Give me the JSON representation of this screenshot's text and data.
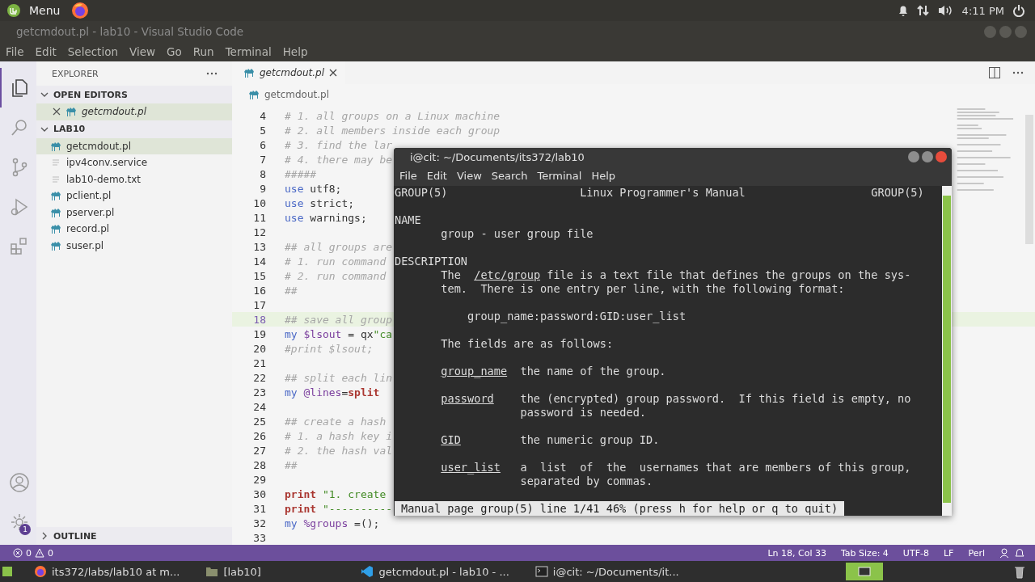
{
  "top_panel": {
    "menu_label": "Menu",
    "clock": "4:11 PM"
  },
  "window": {
    "title": "getcmdout.pl - lab10 - Visual Studio Code"
  },
  "menu_bar": [
    "File",
    "Edit",
    "Selection",
    "View",
    "Go",
    "Run",
    "Terminal",
    "Help"
  ],
  "activity_bar": {
    "items": [
      {
        "selected": true
      },
      {
        "selected": false
      },
      {
        "selected": false
      },
      {
        "selected": false
      },
      {
        "selected": false
      }
    ],
    "settings_badge": "1"
  },
  "sidebar": {
    "title": "EXPLORER",
    "sections": [
      {
        "title": "OPEN EDITORS",
        "expanded": true,
        "items": [
          {
            "name": "getcmdout.pl",
            "kind": "perl",
            "selected": true,
            "closable": true
          }
        ]
      },
      {
        "title": "LAB10",
        "expanded": true,
        "items": [
          {
            "name": "getcmdout.pl",
            "kind": "perl",
            "selected": true,
            "closable": false
          },
          {
            "name": "ipv4conv.service",
            "kind": "text",
            "selected": false,
            "closable": false
          },
          {
            "name": "lab10-demo.txt",
            "kind": "text",
            "selected": false,
            "closable": false
          },
          {
            "name": "pclient.pl",
            "kind": "perl",
            "selected": false,
            "closable": false
          },
          {
            "name": "pserver.pl",
            "kind": "perl",
            "selected": false,
            "closable": false
          },
          {
            "name": "record.pl",
            "kind": "perl",
            "selected": false,
            "closable": false
          },
          {
            "name": "suser.pl",
            "kind": "perl",
            "selected": false,
            "closable": false
          }
        ]
      },
      {
        "title": "OUTLINE",
        "expanded": false
      }
    ]
  },
  "editor": {
    "tab": "getcmdout.pl",
    "breadcrumb": "getcmdout.pl",
    "lines": [
      {
        "number": "4",
        "highlighted": false,
        "tokens": [
          {
            "text": "# 1. all groups on a Linux machine",
            "kind": "comment"
          }
        ]
      },
      {
        "number": "5",
        "highlighted": false,
        "tokens": [
          {
            "text": "# 2. all members inside each group",
            "kind": "comment"
          }
        ]
      },
      {
        "number": "6",
        "highlighted": false,
        "tokens": [
          {
            "text": "# 3. find the lar",
            "kind": "comment"
          }
        ]
      },
      {
        "number": "7",
        "highlighted": false,
        "tokens": [
          {
            "text": "# 4. there may be",
            "kind": "comment"
          }
        ]
      },
      {
        "number": "8",
        "highlighted": false,
        "tokens": [
          {
            "text": "#####",
            "kind": "comment"
          }
        ]
      },
      {
        "number": "9",
        "highlighted": false,
        "tokens": [
          {
            "text": "use",
            "kind": "keyword"
          },
          {
            "text": " utf8;",
            "kind": "plain"
          }
        ]
      },
      {
        "number": "10",
        "highlighted": false,
        "tokens": [
          {
            "text": "use",
            "kind": "keyword"
          },
          {
            "text": " strict;",
            "kind": "plain"
          }
        ]
      },
      {
        "number": "11",
        "highlighted": false,
        "tokens": [
          {
            "text": "use",
            "kind": "keyword"
          },
          {
            "text": " warnings;",
            "kind": "plain"
          }
        ]
      },
      {
        "number": "12",
        "highlighted": false
      },
      {
        "number": "13",
        "highlighted": false,
        "tokens": [
          {
            "text": "## all groups are",
            "kind": "comment"
          }
        ]
      },
      {
        "number": "14",
        "highlighted": false,
        "tokens": [
          {
            "text": "# 1. run command",
            "kind": "comment"
          }
        ]
      },
      {
        "number": "15",
        "highlighted": false,
        "tokens": [
          {
            "text": "# 2. run command",
            "kind": "comment"
          }
        ]
      },
      {
        "number": "16",
        "highlighted": false,
        "tokens": [
          {
            "text": "##",
            "kind": "comment"
          }
        ]
      },
      {
        "number": "17",
        "highlighted": false
      },
      {
        "number": "18",
        "highlighted": true,
        "tokens": [
          {
            "text": "## save all group",
            "kind": "comment"
          }
        ]
      },
      {
        "number": "19",
        "highlighted": false,
        "tokens": [
          {
            "text": "my",
            "kind": "keyword"
          },
          {
            "text": " $lsout",
            "kind": "variable"
          },
          {
            "text": " = qx",
            "kind": "plain"
          },
          {
            "text": "\"ca",
            "kind": "string"
          }
        ]
      },
      {
        "number": "20",
        "highlighted": false,
        "tokens": [
          {
            "text": "#print $lsout;",
            "kind": "comment"
          }
        ]
      },
      {
        "number": "21",
        "highlighted": false
      },
      {
        "number": "22",
        "highlighted": false,
        "tokens": [
          {
            "text": "## split each lin",
            "kind": "comment"
          }
        ]
      },
      {
        "number": "23",
        "highlighted": false,
        "tokens": [
          {
            "text": "my",
            "kind": "keyword"
          },
          {
            "text": " @lines",
            "kind": "variable"
          },
          {
            "text": "=",
            "kind": "plain"
          },
          {
            "text": "split",
            "kind": "function"
          }
        ]
      },
      {
        "number": "24",
        "highlighted": false
      },
      {
        "number": "25",
        "highlighted": false,
        "tokens": [
          {
            "text": "## create a hash",
            "kind": "comment"
          }
        ]
      },
      {
        "number": "26",
        "highlighted": false,
        "tokens": [
          {
            "text": "# 1. a hash key i",
            "kind": "comment"
          }
        ]
      },
      {
        "number": "27",
        "highlighted": false,
        "tokens": [
          {
            "text": "# 2. the hash val",
            "kind": "comment"
          }
        ]
      },
      {
        "number": "28",
        "highlighted": false,
        "tokens": [
          {
            "text": "##",
            "kind": "comment"
          }
        ]
      },
      {
        "number": "29",
        "highlighted": false
      },
      {
        "number": "30",
        "highlighted": false,
        "tokens": [
          {
            "text": "print",
            "kind": "function"
          },
          {
            "text": " \"1. create",
            "kind": "string"
          }
        ]
      },
      {
        "number": "31",
        "highlighted": false,
        "tokens": [
          {
            "text": "print",
            "kind": "function"
          },
          {
            "text": " \"----------",
            "kind": "string"
          }
        ]
      },
      {
        "number": "32",
        "highlighted": false,
        "tokens": [
          {
            "text": "my",
            "kind": "keyword"
          },
          {
            "text": " %groups",
            "kind": "variable"
          },
          {
            "text": " =();",
            "kind": "plain"
          }
        ]
      },
      {
        "number": "33",
        "highlighted": false
      }
    ]
  },
  "terminal": {
    "title": "i@cit: ~/Documents/its372/lab10",
    "menu": [
      "File",
      "Edit",
      "View",
      "Search",
      "Terminal",
      "Help"
    ],
    "blocks": [
      [
        [
          {
            "text": "GROUP(5)                    Linux Programmer's Manual                   GROUP(5)",
            "underlined": false
          }
        ]
      ],
      [
        [
          {
            "text": "NAME",
            "underlined": false
          }
        ],
        [
          {
            "text": "       group - user group file",
            "underlined": false
          }
        ]
      ],
      [
        [
          {
            "text": "DESCRIPTION",
            "underlined": false
          }
        ],
        [
          {
            "text": "       The  ",
            "underlined": false
          },
          {
            "text": "/etc/group",
            "underlined": true
          },
          {
            "text": " file is a text file that defines the groups on the sys-",
            "underlined": false
          }
        ],
        [
          {
            "text": "       tem.  There is one entry per line, with the following format:",
            "underlined": false
          }
        ]
      ],
      [
        [
          {
            "text": "           group_name:password:GID:user_list",
            "underlined": false
          }
        ]
      ],
      [
        [
          {
            "text": "       The fields are as follows:",
            "underlined": false
          }
        ]
      ],
      [
        [
          {
            "text": "group_name",
            "underlined": true
          },
          {
            "text": "  the name of the group.",
            "underlined": false
          }
        ]
      ],
      [
        [
          {
            "text": "password",
            "underlined": true
          },
          {
            "text": "    the (encrypted) group password.  If this field is empty, no",
            "underlined": false
          }
        ],
        [
          {
            "text": "                   password is needed.",
            "underlined": false
          }
        ]
      ],
      [
        [
          {
            "text": "GID",
            "underlined": true
          },
          {
            "text": "         the numeric group ID.",
            "underlined": false
          }
        ]
      ],
      [
        [
          {
            "text": "user_list",
            "underlined": true
          },
          {
            "text": "   a  list  of  the  usernames that are members of this group,",
            "underlined": false
          }
        ],
        [
          {
            "text": "                   separated by commas.",
            "underlined": false
          }
        ]
      ]
    ],
    "status": "Manual page group(5) line 1/41 46% (press h for help or q to quit)"
  },
  "status_bar": {
    "errors": "0",
    "warnings": "0",
    "items": [
      "Ln 18, Col 33",
      "Tab Size: 4",
      "UTF-8",
      "LF",
      "Perl"
    ]
  },
  "taskbar": [
    {
      "label": "its372/labs/lab10 at m...",
      "kind": "browser"
    },
    {
      "label": "[lab10]",
      "kind": "folder"
    },
    {
      "label": "getcmdout.pl - lab10 - ...",
      "kind": "editor"
    },
    {
      "label": "i@cit: ~/Documents/it...",
      "kind": "terminal"
    }
  ]
}
